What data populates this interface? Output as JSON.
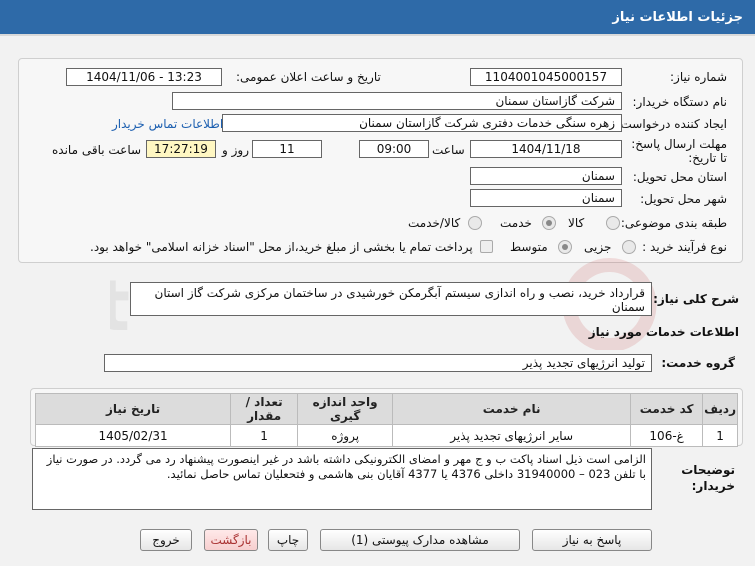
{
  "header": {
    "title": "جزئیات اطلاعات نیاز"
  },
  "fields": {
    "need_number_label": "شماره نیاز:",
    "need_number": "1104001045000157",
    "announce_label": "تاریخ و ساعت اعلان عمومی:",
    "announce_value": "1404/11/06 - 13:23",
    "buyer_org_label": "نام دستگاه خریدار:",
    "buyer_org": "شرکت گازاستان سمنان",
    "creator_label": "ایجاد کننده درخواست:",
    "creator": "زهره سنگی خدمات دفتری شرکت گازاستان سمنان",
    "contact_link": "اطلاعات تماس خریدار",
    "deadline_label": "مهلت ارسال پاسخ: تا تاریخ:",
    "deadline_date": "1404/11/18",
    "time_label": "ساعت",
    "deadline_time": "09:00",
    "days_value": "11",
    "days_label": "روز و",
    "remaining_time": "17:27:19",
    "remaining_label": "ساعت باقی مانده",
    "province_label": "استان محل تحویل:",
    "province": "سمنان",
    "city_label": "شهر محل تحویل:",
    "city": "سمنان",
    "category_label": "طبقه بندی موضوعی:",
    "category_options": [
      "کالا",
      "خدمت",
      "کالا/خدمت"
    ],
    "process_label": "نوع فرآیند خرید :",
    "process_options": [
      "جزیی",
      "متوسط"
    ],
    "payment_note": "پرداخت تمام یا بخشی از مبلغ خرید،از محل \"اسناد خزانه اسلامی\" خواهد بود."
  },
  "summary": {
    "label": "شرح کلی نیاز:",
    "text": "قرارداد خرید، نصب و راه اندازی سیستم آبگرمکن خورشیدی در ساختمان مرکزی شرکت گاز استان سمنان"
  },
  "services": {
    "section_title": "اطلاعات خدمات مورد نیاز",
    "group_label": "گروه خدمت:",
    "group_value": "تولید انرژیهای تجدید پذیر",
    "columns": [
      "ردیف",
      "کد خدمت",
      "نام خدمت",
      "واحد اندازه گیری",
      "تعداد / مقدار",
      "تاریخ نیاز"
    ],
    "rows": [
      [
        "1",
        "غ-106",
        "سایر انرژیهای تجدید پذیر",
        "پروژه",
        "1",
        "1405/02/31"
      ]
    ]
  },
  "buyer_notes": {
    "label": "توضیحات خریدار:",
    "line1": "الزامی است ذیل اسناد پاکت ب و ج مهر و امضای الکترونیکی داشته باشد در غیر اینصورت پیشنهاد رد می گردد. در صورت نیاز",
    "line2": "با تلفن 023 – 31940000  داخلی 4376 یا 4377 آقایان بنی هاشمی و فتحعلیان تماس حاصل نمائید."
  },
  "buttons": {
    "reply": "پاسخ به نیاز",
    "docs": "مشاهده مدارک پیوستی (1)",
    "print": "چاپ",
    "back": "بازگشت",
    "exit": "خروج"
  },
  "colors": {
    "header_bg": "#2e6aa8",
    "highlight": "#fff7c2",
    "link": "#1c5fb0"
  }
}
